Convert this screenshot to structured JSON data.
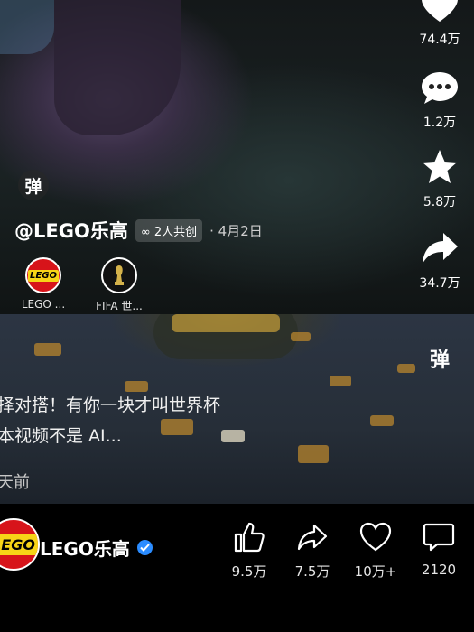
{
  "top_video": {
    "danmu_label": "弹",
    "author": "@LEGO乐高",
    "cocreate_badge": "2人共创",
    "date_sep": "·",
    "date": "4月2日",
    "collaborators": [
      {
        "name": "LEGO ...",
        "icon": "lego-logo"
      },
      {
        "name": "FIFA 世...",
        "icon": "fifa-trophy-logo"
      }
    ],
    "rail": {
      "like_count": "74.4万",
      "comment_count": "1.2万",
      "favorite_count": "5.8万",
      "share_count": "34.7万"
    }
  },
  "bottom_video": {
    "danmu_label": "弹",
    "caption_line1": "择对搭！有你一块才叫世界杯",
    "caption_line2": "本视频不是 AI...",
    "time_ago": "天前"
  },
  "bar": {
    "profile_logo": "LEGO",
    "name": "LEGO乐高",
    "actions": [
      {
        "icon": "thumbs-up-icon",
        "count": "9.5万"
      },
      {
        "icon": "share-arrow-icon",
        "count": "7.5万"
      },
      {
        "icon": "heart-outline-icon",
        "count": "10万+"
      },
      {
        "icon": "comment-outline-icon",
        "count": "2120"
      }
    ]
  },
  "colors": {
    "verified": "#2b8cff",
    "lego_red": "#d7141a",
    "lego_yellow": "#f7d417"
  }
}
